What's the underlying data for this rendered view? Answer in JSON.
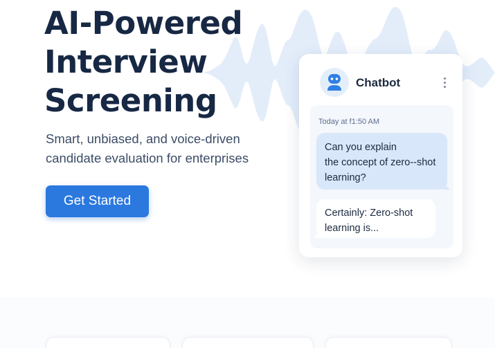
{
  "hero": {
    "title_lines": [
      "AI-Powered",
      "Interview",
      "Screening"
    ],
    "subtitle_lines": [
      "Smart, unbiased, and voice-driven",
      "candidate evaluation for enterprises"
    ],
    "cta_label": "Get Started"
  },
  "chat": {
    "title": "Chatbot",
    "timestamp": "Today at f1:50 AM",
    "user_message_lines": [
      "Can you explain",
      "the concept of zero--shot",
      "learning?"
    ],
    "bot_message_lines": [
      "Certainly: Zero-shot",
      "learning is..."
    ]
  },
  "colors": {
    "accent": "#2b78de",
    "heading": "#172844",
    "user_bubble": "#d9e7fa",
    "wave": "#e3edfa"
  },
  "icons": {
    "avatar": "robot-icon",
    "menu": "more-vertical-icon",
    "decoration": "sound-wave-icon"
  }
}
